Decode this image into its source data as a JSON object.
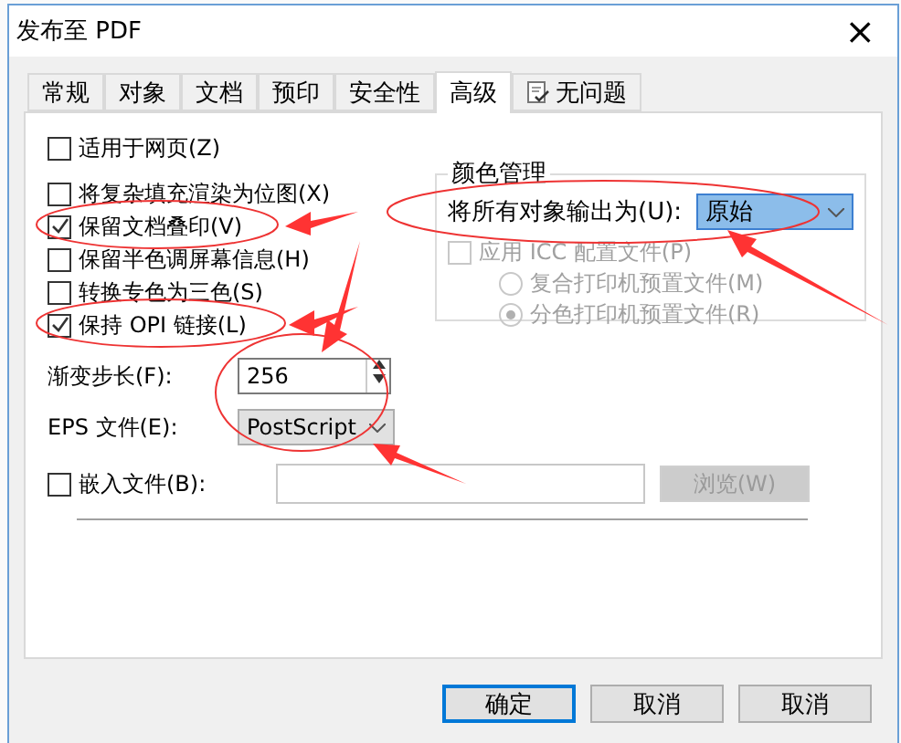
{
  "window": {
    "title": "发布至 PDF",
    "close": "×"
  },
  "tabs": [
    {
      "label": "常规",
      "selected": false,
      "kind": "text"
    },
    {
      "label": "对象",
      "selected": false,
      "kind": "text"
    },
    {
      "label": "文档",
      "selected": false,
      "kind": "text"
    },
    {
      "label": "预印",
      "selected": false,
      "kind": "text"
    },
    {
      "label": "安全性",
      "selected": false,
      "kind": "text"
    },
    {
      "label": "高级",
      "selected": true,
      "kind": "text"
    },
    {
      "label": "无问题",
      "selected": false,
      "kind": "icon"
    }
  ],
  "options": [
    {
      "label": "适用于网页(Z)",
      "checked": false
    },
    {
      "label": "将复杂填充渲染为位图(X)",
      "checked": false
    },
    {
      "label": "保留文档叠印(V)",
      "checked": true
    },
    {
      "label": "保留半色调屏幕信息(H)",
      "checked": false
    },
    {
      "label": "转换专色为三色(S)",
      "checked": false
    },
    {
      "label": "保持 OPI 链接(L)",
      "checked": true
    }
  ],
  "gradient_steps": {
    "label": "渐变步长(F):",
    "value": "256"
  },
  "eps_file": {
    "label": "EPS 文件(E):",
    "value": "PostScript"
  },
  "embed_file": {
    "label": "嵌入文件(B):",
    "checked": false,
    "browse": {
      "label": "浏览(W)",
      "disabled": true
    }
  },
  "color_management": {
    "title": "颜色管理",
    "output_label": "将所有对象输出为(U):",
    "output_value": "原始",
    "icc": {
      "label": "应用 ICC 配置文件(P)",
      "checked": false,
      "disabled": true
    },
    "profiles": [
      {
        "label": "复合打印机预置文件(M)",
        "selected": false,
        "disabled": true
      },
      {
        "label": "分色打印机预置文件(R)",
        "selected": true,
        "disabled": true
      }
    ]
  },
  "buttons": [
    {
      "label": "确定",
      "default": true
    },
    {
      "label": "取消",
      "default": false
    },
    {
      "label": "取消",
      "default": false
    }
  ]
}
